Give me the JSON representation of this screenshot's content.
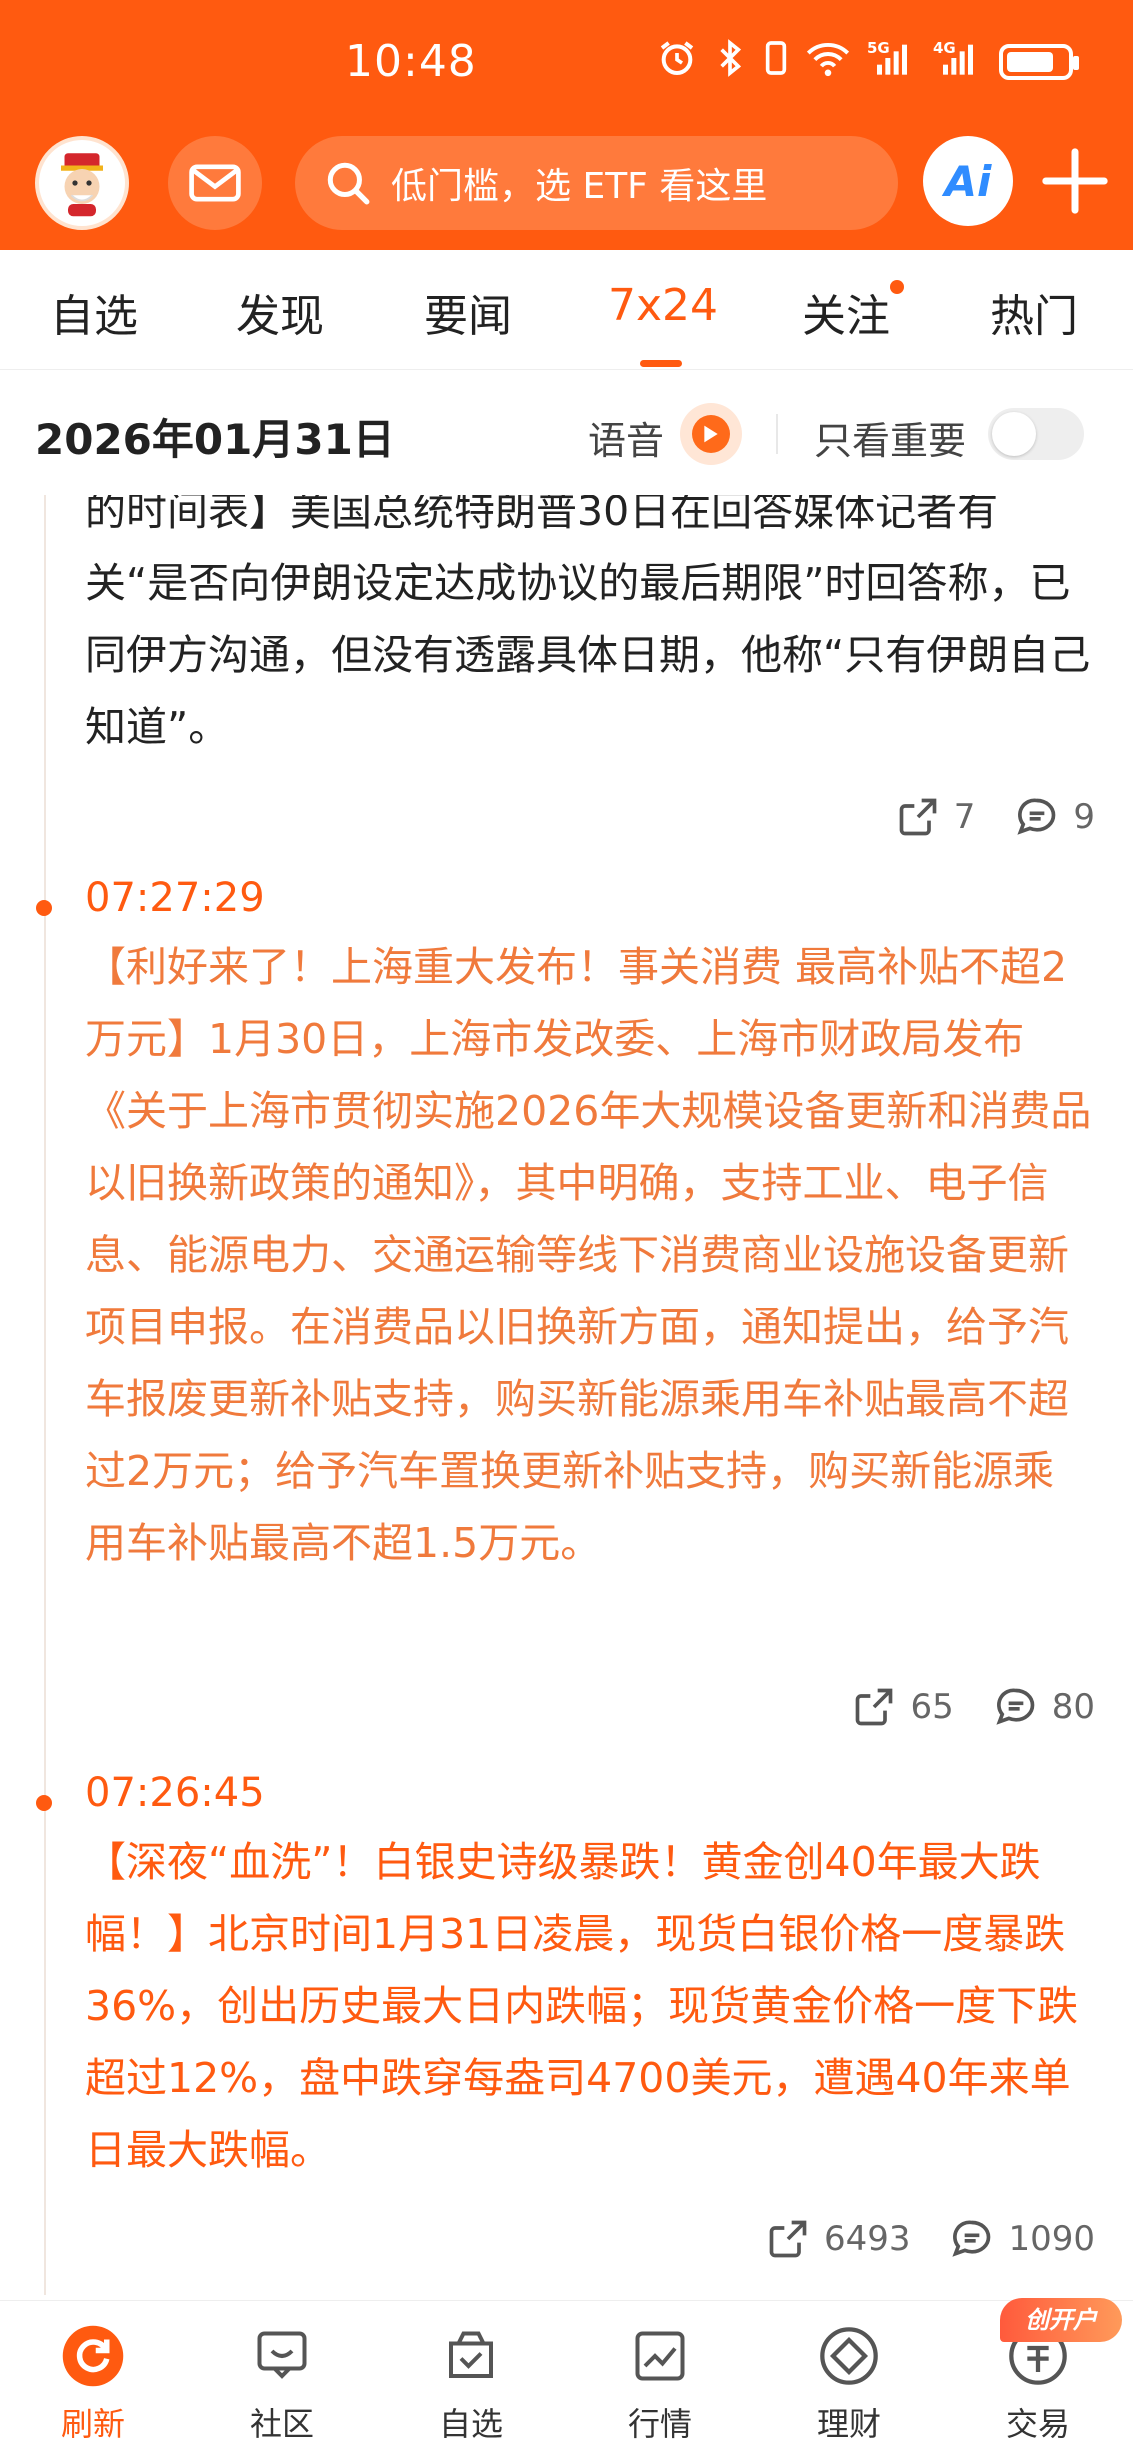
{
  "status": {
    "time": "10:48",
    "battery_level": 0.8
  },
  "header": {
    "search_placeholder": "低门槛，选 ETF 看这里",
    "ai_label": "Ai"
  },
  "tabs": [
    {
      "label": "自选"
    },
    {
      "label": "发现"
    },
    {
      "label": "要闻"
    },
    {
      "label": "7x24",
      "active": true
    },
    {
      "label": "关注",
      "dot": true
    },
    {
      "label": "热门"
    }
  ],
  "date_row": {
    "date": "2026年01月31日",
    "voice_label": "语音",
    "important_only_label": "只看重要",
    "important_only_on": false
  },
  "news": [
    {
      "time": "",
      "body": "的时间表】美国总统特朗普30日在回答媒体记者有关“是否向伊朗设定达成协议的最后期限”时回答称，已同伊方沟通，但没有透露具体日期，他称“只有伊朗自己知道”。",
      "shares": "7",
      "comments": "9"
    },
    {
      "time": "07:27:29",
      "body": "【利好来了！上海重大发布！事关消费 最高补贴不超2万元】1月30日，上海市发改委、上海市财政局发布《关于上海市贯彻实施2026年大规模设备更新和消费品以旧换新政策的通知》，其中明确，支持工业、电子信息、能源电力、交通运输等线下消费商业设施设备更新项目申报。在消费品以旧换新方面，通知提出，给予汽车报废更新补贴支持，购买新能源乘用车补贴最高不超过2万元；给予汽车置换更新补贴支持，购买新能源乘用车补贴最高不超1.5万元。",
      "shares": "65",
      "comments": "80"
    },
    {
      "time": "07:26:45",
      "body": "【深夜“血洗”！白银史诗级暴跌！黄金创40年最大跌幅！】北京时间1月31日凌晨，现货白银价格一度暴跌36%，创出历史最大日内跌幅；现货黄金价格一度下跌超过12%，盘中跌穿每盎司4700美元，遭遇40年来单日最大跌幅。",
      "shares": "6493",
      "comments": "1090"
    }
  ],
  "bottom_nav": [
    {
      "label": "刷新",
      "icon": "refresh-icon",
      "active": true
    },
    {
      "label": "社区",
      "icon": "community-icon"
    },
    {
      "label": "自选",
      "icon": "watchlist-icon"
    },
    {
      "label": "行情",
      "icon": "market-icon"
    },
    {
      "label": "理财",
      "icon": "wealth-icon"
    },
    {
      "label": "交易",
      "icon": "trade-icon"
    }
  ],
  "open_account_badge": "创开户",
  "colors": {
    "brand": "#ff5a10",
    "important_text": "#f07a3c"
  }
}
